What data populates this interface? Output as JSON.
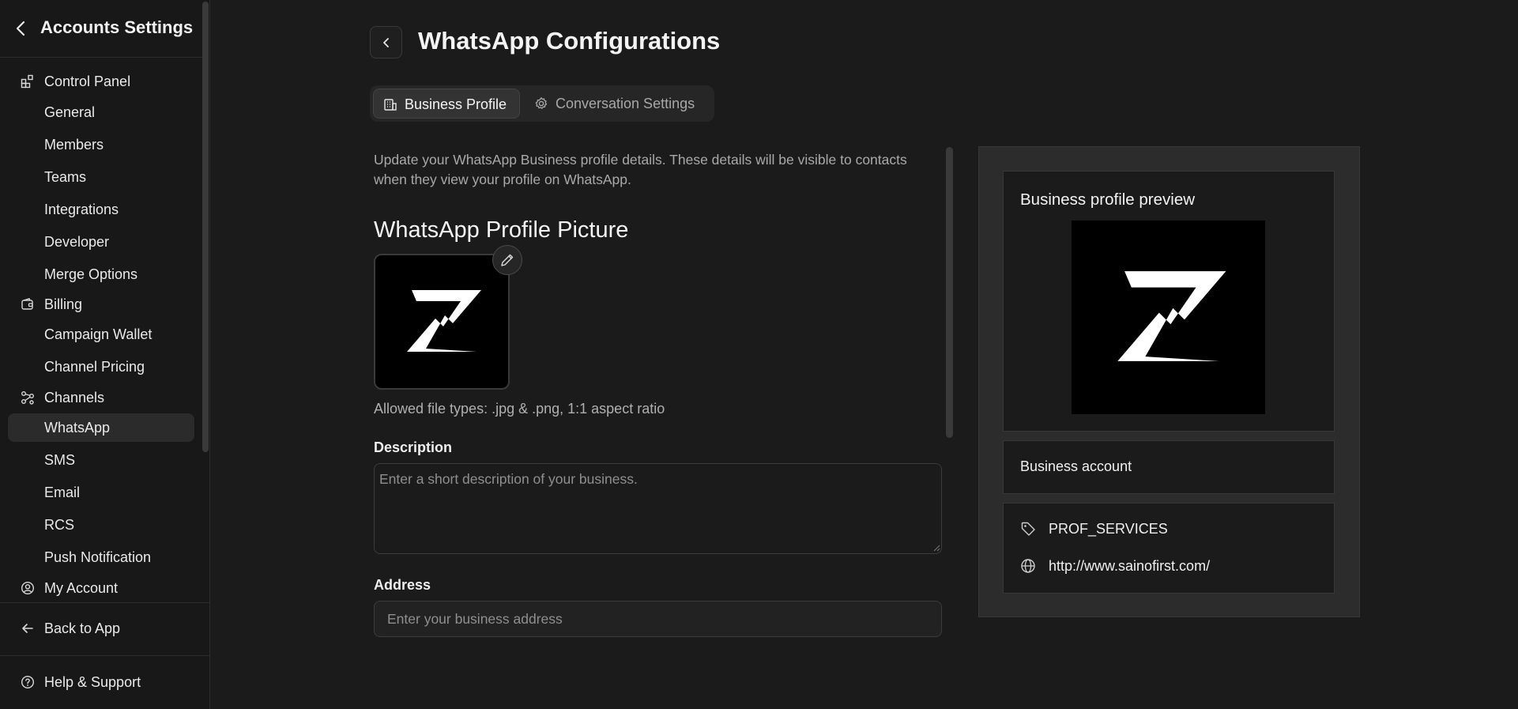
{
  "sidebar": {
    "title": "Accounts Settings",
    "sections": {
      "control_panel": "Control Panel",
      "billing": "Billing",
      "channels": "Channels",
      "my_account": "My Account"
    },
    "items": {
      "general": "General",
      "members": "Members",
      "teams": "Teams",
      "integrations": "Integrations",
      "developer": "Developer",
      "merge_options": "Merge Options",
      "campaign_wallet": "Campaign Wallet",
      "channel_pricing": "Channel Pricing",
      "whatsapp": "WhatsApp",
      "sms": "SMS",
      "email": "Email",
      "rcs": "RCS",
      "push_notification": "Push Notification"
    },
    "footer": {
      "back_to_app": "Back to App",
      "help_support": "Help & Support"
    },
    "active_item": "WhatsApp"
  },
  "header": {
    "title": "WhatsApp Configurations"
  },
  "tabs": [
    {
      "label": "Business Profile",
      "icon": "building-icon",
      "active": true
    },
    {
      "label": "Conversation Settings",
      "icon": "gear-icon",
      "active": false
    }
  ],
  "form": {
    "intro": "Update your WhatsApp Business profile details. These details will be visible to contacts when they view your profile on WhatsApp.",
    "picture_heading": "WhatsApp Profile Picture",
    "file_hint": "Allowed file types: .jpg & .png, 1:1 aspect ratio",
    "description_label": "Description",
    "description_placeholder": "Enter a short description of your business.",
    "description_value": "",
    "address_label": "Address",
    "address_placeholder": "Enter your business address",
    "address_value": ""
  },
  "preview": {
    "title": "Business profile preview",
    "account_label": "Business account",
    "category": "PROF_SERVICES",
    "website": "http://www.sainofirst.com/"
  },
  "colors": {
    "background": "#1b1b1b",
    "sidebar": "#181818",
    "active_item": "#2b2b2b",
    "panel": "#2c2c2c",
    "text": "#ececec",
    "muted": "#a9a9a9"
  }
}
